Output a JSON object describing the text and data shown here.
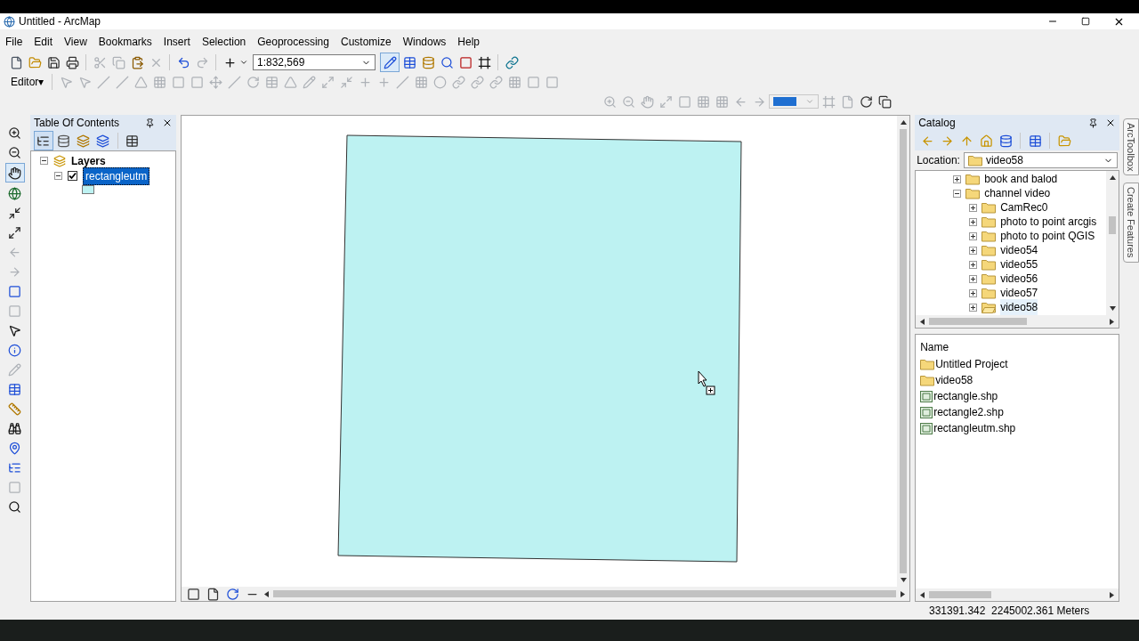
{
  "window": {
    "title": "Untitled - ArcMap"
  },
  "menu": [
    "File",
    "Edit",
    "View",
    "Bookmarks",
    "Insert",
    "Selection",
    "Geoprocessing",
    "Customize",
    "Windows",
    "Help"
  ],
  "standard_toolbar": {
    "scale": "1:832,569"
  },
  "editor_toolbar": {
    "label": "Editor▾"
  },
  "toc": {
    "title": "Table Of Contents",
    "layers": [
      {
        "label": "Layers",
        "expanded": true,
        "children": [
          {
            "label": "rectangleutm",
            "expanded": true,
            "checked": true,
            "selected": true
          }
        ]
      }
    ]
  },
  "catalog": {
    "title": "Catalog",
    "location_label": "Location:",
    "location": "video58",
    "tree": [
      {
        "label": "book and balod",
        "expanded": false,
        "selected": false
      },
      {
        "label": "channel video",
        "expanded": true,
        "selected": false,
        "children": [
          {
            "label": "CamRec0",
            "expanded": false,
            "selected": false
          },
          {
            "label": "photo to point arcgis",
            "expanded": false,
            "selected": false
          },
          {
            "label": "photo to point QGIS",
            "expanded": false,
            "selected": false
          },
          {
            "label": "video54",
            "expanded": false,
            "selected": false
          },
          {
            "label": "video55",
            "expanded": false,
            "selected": false
          },
          {
            "label": "video56",
            "expanded": false,
            "selected": false
          },
          {
            "label": "video57",
            "expanded": false,
            "selected": false
          },
          {
            "label": "video58",
            "expanded": false,
            "selected": true
          }
        ]
      }
    ],
    "list_header": "Name",
    "items": [
      {
        "label": "Untitled Project",
        "kind": "folder"
      },
      {
        "label": "video58",
        "kind": "folder"
      },
      {
        "label": "rectangle.shp",
        "kind": "shapefile"
      },
      {
        "label": "rectangle2.shp",
        "kind": "shapefile"
      },
      {
        "label": "rectangleutm.shp",
        "kind": "shapefile"
      }
    ]
  },
  "side_tabs": [
    "ArcToolbox",
    "Create Features"
  ],
  "status_bar": {
    "coordinates": "331391.342  2245002.361 Meters"
  }
}
